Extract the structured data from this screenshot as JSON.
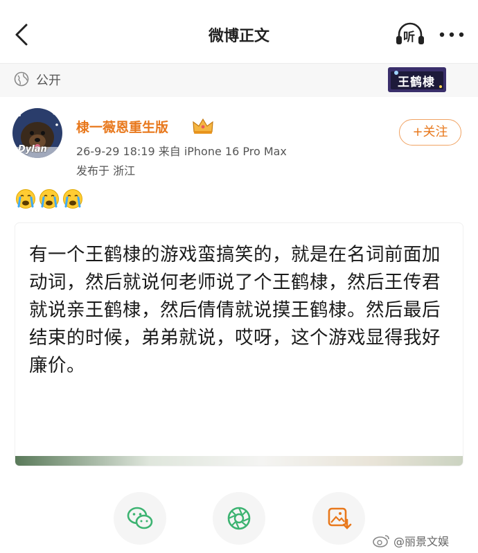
{
  "nav": {
    "title": "微博正文",
    "listen_label": "听"
  },
  "visibility": {
    "label": "公开",
    "sticker_text": "王鹤棣"
  },
  "post": {
    "username": "棣一薇恩重生版",
    "meta": "26-9-29 18:19  来自 iPhone 16 Pro Max",
    "location": "发布于 浙江",
    "follow_label": "+关注",
    "avatar_text": "Dylan",
    "emojis": [
      "crying-face",
      "crying-face",
      "crying-face"
    ],
    "image_text": "有一个王鹤棣的游戏蛮搞笑的，就是在名词前面加动词，然后就说何老师说了个王鹤棣，然后王传君就说亲王鹤棣，然后倩倩就说摸王鹤棣。然后最后结束的时候，弟弟就说，哎呀，这个游戏显得我好廉价。"
  },
  "share": {
    "items": [
      {
        "name": "wechat",
        "icon": "wechat-icon"
      },
      {
        "name": "moments",
        "icon": "moments-icon"
      },
      {
        "name": "save-image",
        "icon": "save-image-icon"
      }
    ]
  },
  "watermark": "@丽景文娱",
  "colors": {
    "accent": "#e8781c",
    "share_icon": "#3cb371"
  }
}
